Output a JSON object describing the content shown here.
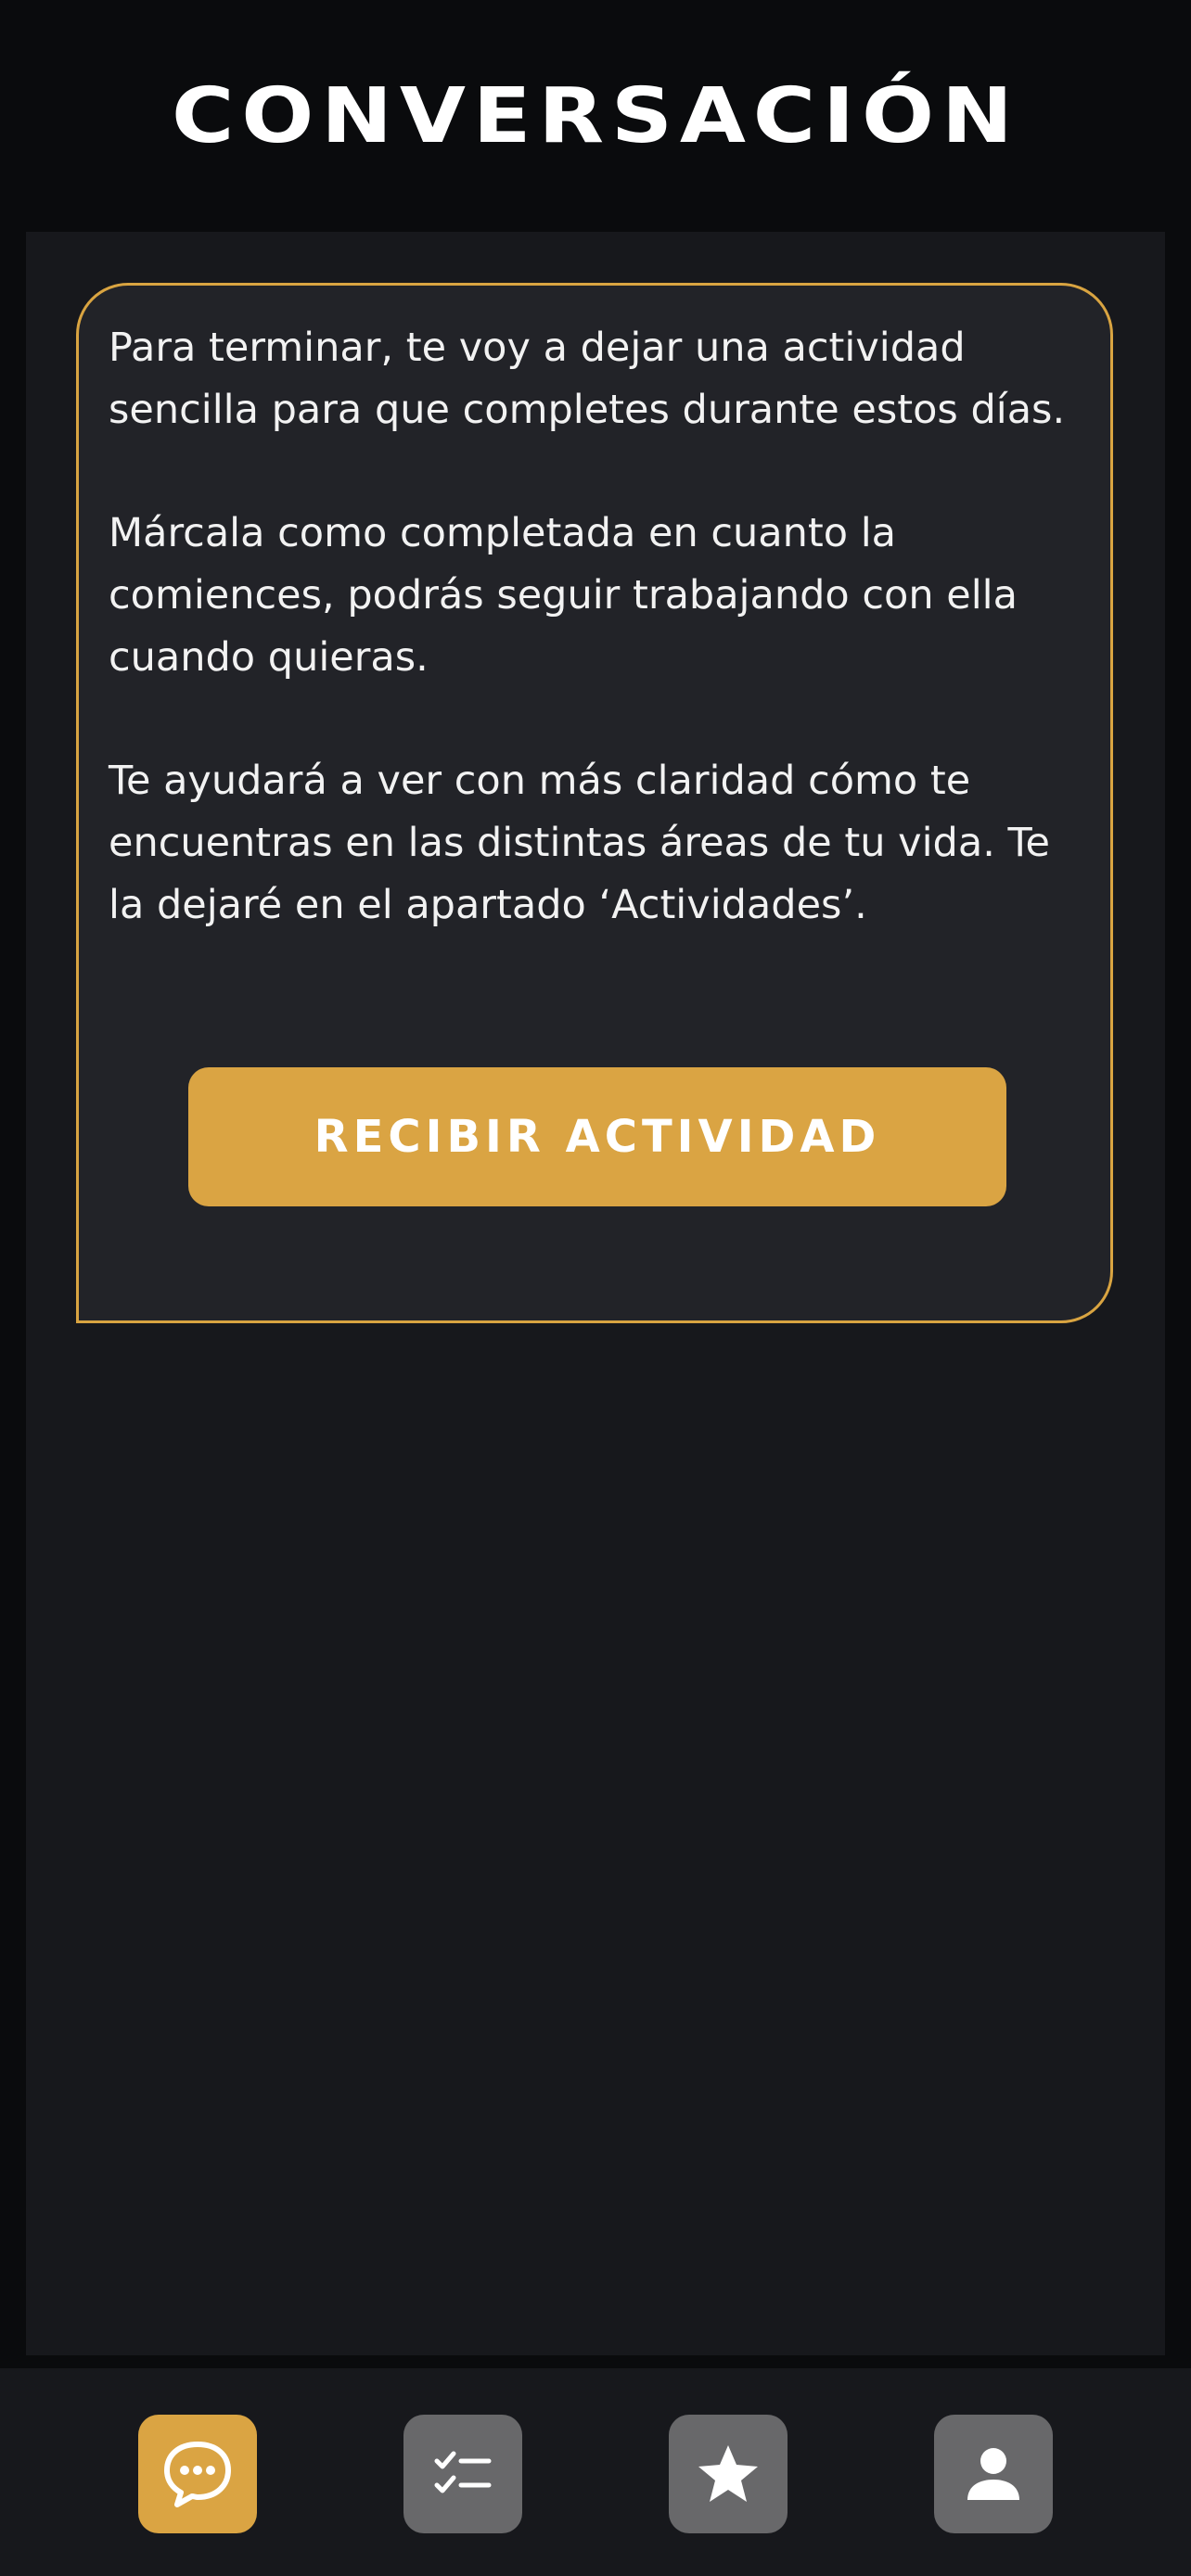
{
  "header": {
    "title": "CONVERSACIÓN"
  },
  "message": {
    "paragraphs": [
      "Para terminar, te voy a dejar una actividad sencilla para que completes durante estos días.",
      "Márcala como completada en cuanto la comiences, podrás seguir trabajando con ella cuando quieras.",
      "Te ayudará a ver con más claridad cómo te encuentras en las distintas áreas de tu vida. Te la dejaré en el apartado ‘Actividades’."
    ],
    "button_label": "Recibir actividad"
  },
  "nav": {
    "items": [
      {
        "icon": "chat-bubble-icon",
        "active": true
      },
      {
        "icon": "checklist-icon",
        "active": false
      },
      {
        "icon": "star-icon",
        "active": false
      },
      {
        "icon": "person-icon",
        "active": false
      }
    ]
  },
  "colors": {
    "accent": "#daa443",
    "card_border": "#d9a441",
    "background": "#0a0b0d",
    "panel": "#17181c",
    "card": "#222328",
    "nav_inactive": "#68686a",
    "text": "#ffffff"
  }
}
